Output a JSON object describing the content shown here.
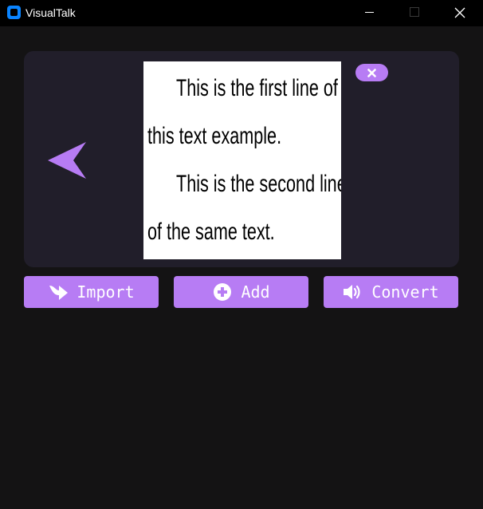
{
  "window": {
    "title": "VisualTalk"
  },
  "preview": {
    "lines": [
      "This is the first line of",
      "this text example.",
      "This is the second line",
      "of the same text."
    ]
  },
  "toolbar": {
    "import_label": "Import",
    "add_label": "Add",
    "convert_label": "Convert"
  },
  "icons": {
    "prev": "arrow-left-icon",
    "remove": "close-icon",
    "import": "share-arrow-icon",
    "add": "plus-circle-icon",
    "convert": "volume-icon"
  },
  "colors": {
    "accent": "#b77cf4",
    "background": "#141314",
    "panel": "#211e2a",
    "titlebar": "#000000"
  }
}
